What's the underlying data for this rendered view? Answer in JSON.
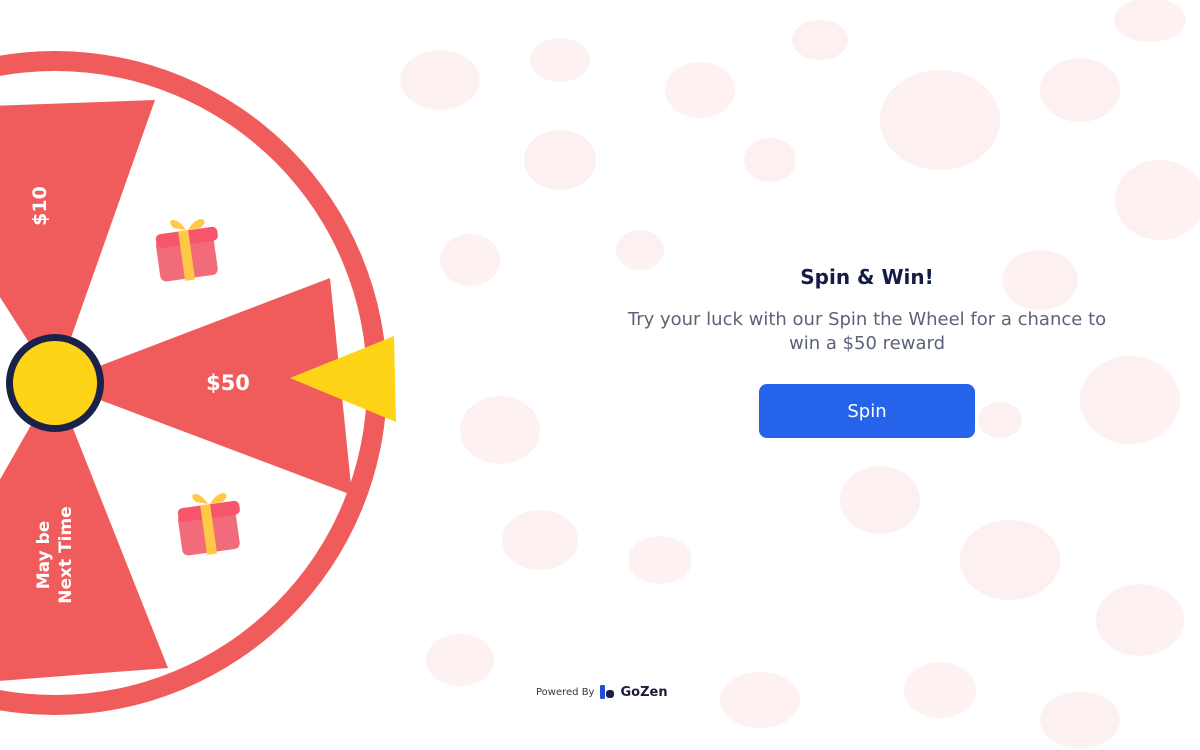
{
  "wheel": {
    "segments": [
      {
        "label": "$10",
        "type": "prize"
      },
      {
        "label": "",
        "type": "gift"
      },
      {
        "label": "$50",
        "type": "prize"
      },
      {
        "label": "",
        "type": "gift"
      },
      {
        "label": "May be Next Time",
        "type": "no-prize"
      }
    ],
    "label_10": "$10",
    "label_50": "$50",
    "label_maybe": "May be Next Time",
    "icons": [
      "gift-icon",
      "gift-icon",
      "pointer-icon",
      "wheel-center-icon"
    ]
  },
  "promo": {
    "title": "Spin & Win!",
    "description": "Try your luck with our Spin the Wheel for a chance to win a $50 reward",
    "button_label": "Spin"
  },
  "footer": {
    "powered_by": "Powered By",
    "brand": "GoZen",
    "brand_icon": "gozen-logo-icon"
  },
  "colors": {
    "wheel_red": "#f05c5c",
    "wheel_white": "#ffffff",
    "center_yellow": "#ffd417",
    "center_ring": "#1b2148",
    "pointer_yellow": "#ffd417",
    "button_blue": "#2563eb",
    "title_navy": "#141b46",
    "text_gray": "#5a6377",
    "bg_blob": "#fdeeee"
  }
}
